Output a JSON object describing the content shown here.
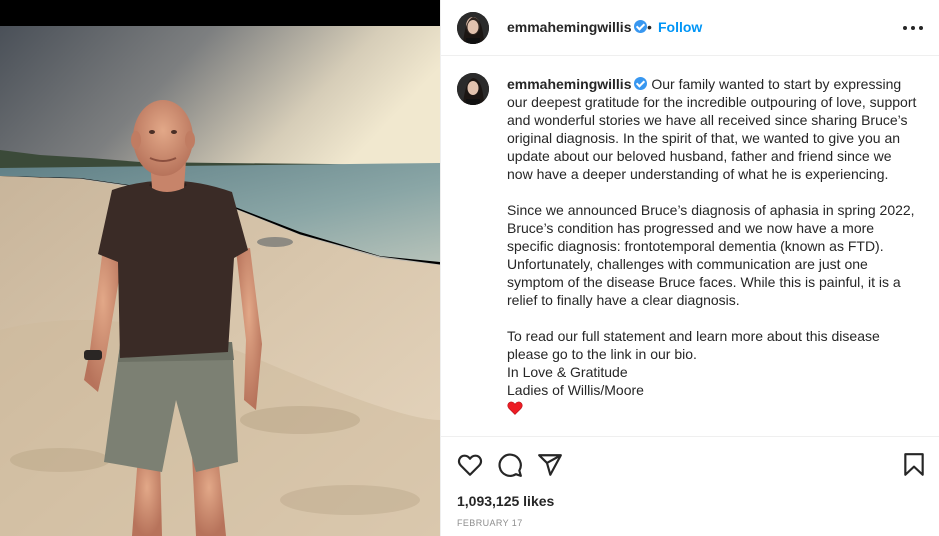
{
  "post": {
    "username": "emmahemingwillis",
    "verified": true,
    "follow_label": "Follow",
    "separator": "•",
    "more_icon": "more-horizontal-icon",
    "photo_alt": "Man in dark t-shirt and grey shorts standing on a sandy beach at sunset"
  },
  "caption": {
    "username": "emmahemingwillis",
    "paragraph1": "Our family wanted to start by expressing our deepest gratitude for the incredible outpouring of love, support and wonderful stories we have all received since sharing Bruce’s original diagnosis. In the spirit of that, we wanted to give you an update about our beloved husband, father and friend since we now have a deeper understanding of what he is experiencing.",
    "paragraph2": "Since we announced Bruce’s diagnosis of aphasia in spring 2022, Bruce’s condition has progressed and we now have a more specific diagnosis: frontotemporal dementia (known as FTD). Unfortunately, challenges with communication are just one symptom of the disease Bruce faces. While this is painful, it is a relief to finally have a clear diagnosis.",
    "paragraph3": "To read our full statement and learn more about this disease please go to the link in our bio.",
    "signoff1": "In Love & Gratitude",
    "signoff2": "Ladies of Willis/Moore",
    "emoji": "red-heart-emoji"
  },
  "actions": {
    "like_icon": "heart-icon",
    "comment_icon": "comment-icon",
    "share_icon": "send-icon",
    "save_icon": "bookmark-icon"
  },
  "stats": {
    "likes": "1,093,125 likes",
    "date": "FEBRUARY 17"
  },
  "colors": {
    "link_blue": "#0095f6",
    "verified_blue": "#3897f0",
    "text": "#262626",
    "muted": "#8e8e8e",
    "heart_red": "#ed1c24"
  }
}
